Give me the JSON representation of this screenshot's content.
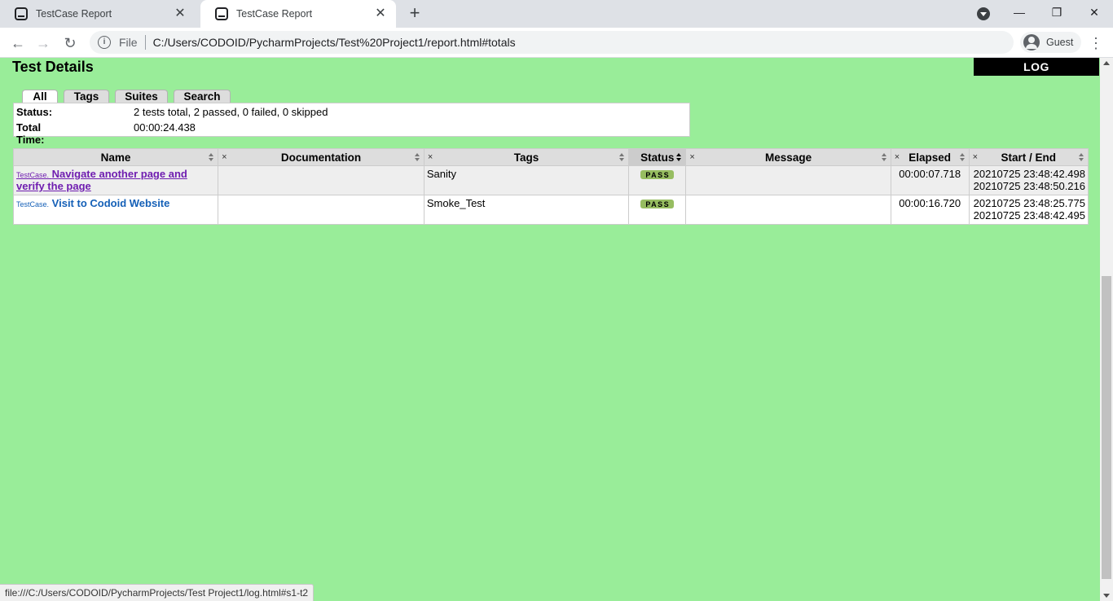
{
  "browser": {
    "tabs": [
      {
        "title": "TestCase Report"
      },
      {
        "title": "TestCase Report"
      }
    ],
    "url_scheme_label": "File",
    "url": "C:/Users/CODOID/PycharmProjects/Test%20Project1/report.html#totals",
    "profile_label": "Guest",
    "status_url": "file:///C:/Users/CODOID/PycharmProjects/Test Project1/log.html#s1-t2"
  },
  "page": {
    "title": "Test Details",
    "log_button": "LOG",
    "detail_tabs": [
      "All",
      "Tags",
      "Suites",
      "Search"
    ],
    "summary": {
      "status_label": "Status:",
      "status_value": "2 tests total, 2 passed, 0 failed, 0 skipped",
      "time_label": "Total Time:",
      "time_value": "00:00:24.438"
    },
    "table": {
      "headers": [
        "Name",
        "Documentation",
        "Tags",
        "Status",
        "Message",
        "Elapsed",
        "Start / End"
      ],
      "hide_symbol": "×",
      "rows": [
        {
          "parent": "TestCase",
          "name": "Navigate another page and verify the page",
          "documentation": "",
          "tags": "Sanity",
          "status": "PASS",
          "message": "",
          "elapsed": "00:00:07.718",
          "start": "20210725 23:48:42.498",
          "end": "20210725 23:48:50.216"
        },
        {
          "parent": "TestCase",
          "name": "Visit to Codoid Website",
          "documentation": "",
          "tags": "Smoke_Test",
          "status": "PASS",
          "message": "",
          "elapsed": "00:00:16.720",
          "start": "20210725 23:48:25.775",
          "end": "20210725 23:48:42.495"
        }
      ]
    }
  },
  "colors": {
    "page_background": "#99ed99",
    "pass_label": "#97bd61",
    "link": "#1560b7",
    "visited_link": "#6f1db0"
  }
}
